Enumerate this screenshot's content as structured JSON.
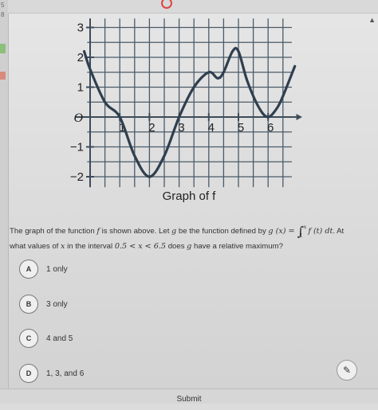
{
  "graph": {
    "caption": "Graph of f",
    "x_ticks": [
      "1",
      "2",
      "3",
      "4",
      "5",
      "6"
    ],
    "y_ticks": [
      "3",
      "2",
      "1",
      "−1",
      "−2"
    ],
    "origin_label": "O"
  },
  "chart_data": {
    "type": "line",
    "title": "Graph of f",
    "xlabel": "",
    "ylabel": "",
    "xlim": [
      -0.5,
      6.8
    ],
    "ylim": [
      -2.3,
      3.3
    ],
    "grid": true,
    "series": [
      {
        "x": [
          -0.2,
          0,
          0.5,
          1,
          1.5,
          2,
          2.5,
          3,
          3.5,
          4,
          4.3,
          4.5,
          4.8,
          5,
          5.3,
          5.7,
          6,
          6.3,
          6.5,
          6.9
        ],
        "y": [
          2.2,
          1.6,
          0.5,
          0,
          -1.3,
          -2,
          -1.3,
          0,
          1.0,
          1.5,
          1.3,
          1.5,
          2.2,
          2.2,
          1.2,
          0.3,
          0,
          0.3,
          0.7,
          1.7
        ]
      }
    ]
  },
  "question": {
    "intro": "The graph of the function ",
    "f": "f",
    "mid": " is shown above. Let ",
    "g": "g",
    "be": " be the function defined by ",
    "gx": "g (x) = ",
    "integral": "∫",
    "upper": "x",
    "lower": "1",
    "integrand": "f (t) dt",
    "end": ". At",
    "line2_prefix": "what values of ",
    "x": "x",
    "line2_mid": " in the interval ",
    "interval": "0.5 < x < 6.5",
    "line2_mid2": " does ",
    "g2": "g",
    "line2_end": " have a relative maximum?"
  },
  "options": [
    {
      "letter": "A",
      "text": "1 only"
    },
    {
      "letter": "B",
      "text": "3 only"
    },
    {
      "letter": "C",
      "text": "4 and 5"
    },
    {
      "letter": "D",
      "text": "1, 3, and 6"
    }
  ],
  "left_edge_digits": [
    "5",
    "8"
  ],
  "submit_label": "Submit"
}
